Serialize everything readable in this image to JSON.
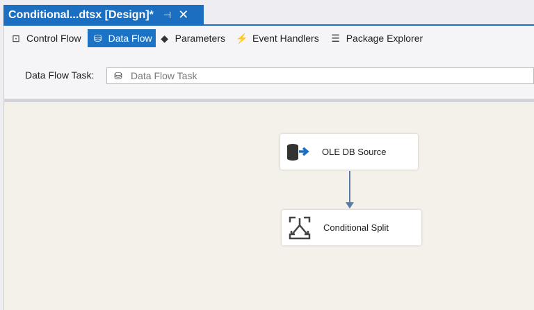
{
  "document_tab": {
    "title": "Conditional...dtsx [Design]*",
    "pin_icon": "pin-icon",
    "close_icon": "close-icon"
  },
  "toolbar": {
    "items": [
      {
        "label": "Control Flow",
        "icon": "control-flow-icon"
      },
      {
        "label": "Data Flow",
        "icon": "data-flow-icon",
        "active": true
      },
      {
        "label": "Parameters",
        "icon": "parameters-icon"
      },
      {
        "label": "Event Handlers",
        "icon": "event-handlers-icon"
      },
      {
        "label": "Package Explorer",
        "icon": "package-explorer-icon"
      }
    ]
  },
  "task_selector": {
    "label": "Data Flow Task:",
    "value": "Data Flow Task"
  },
  "canvas": {
    "nodes": [
      {
        "label": "OLE DB Source",
        "icon": "ole-db-source-icon"
      },
      {
        "label": "Conditional Split",
        "icon": "conditional-split-icon"
      }
    ]
  },
  "colors": {
    "accent": "#1c6fc0",
    "canvas": "#f4f1ea",
    "connector": "#5a7aa8"
  }
}
